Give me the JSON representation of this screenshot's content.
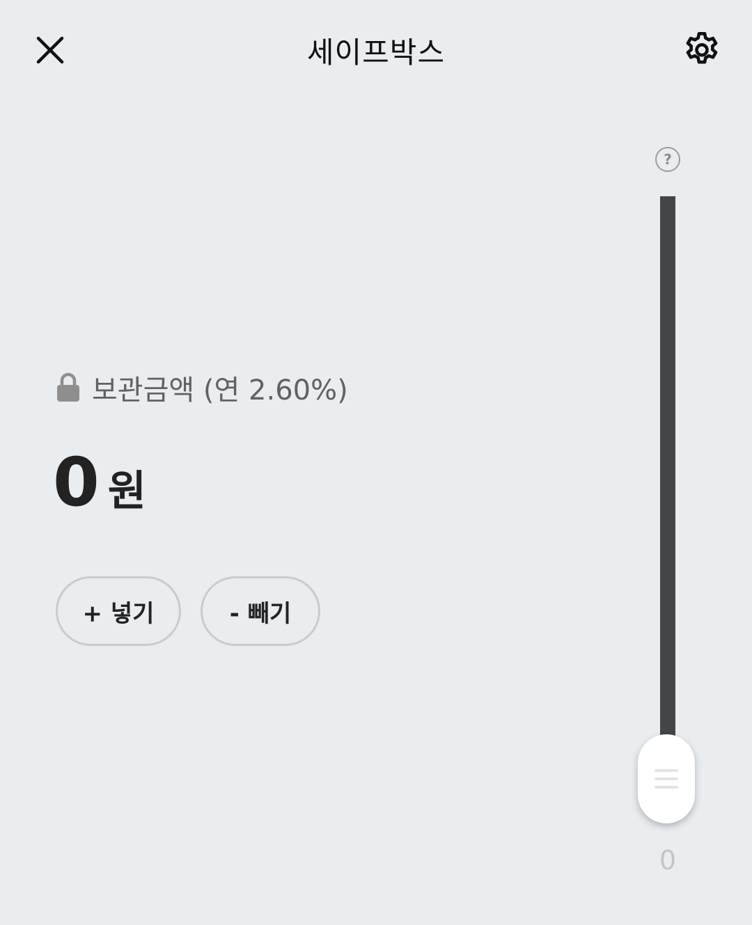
{
  "header": {
    "title": "세이프박스",
    "close_icon": "close-icon",
    "settings_icon": "gear-icon"
  },
  "balance": {
    "lock_icon": "lock-icon",
    "label": "보관금액 (연 2.60%)",
    "amount": "0",
    "unit": "원"
  },
  "actions": {
    "deposit_label": "+ 넣기",
    "withdraw_label": "- 빼기"
  },
  "slider": {
    "help_icon": "help-icon",
    "value_label": "0",
    "level": 0,
    "track_color": "#444546"
  },
  "colors": {
    "background": "#eaedf0",
    "button_border": "#c9cbcd"
  }
}
